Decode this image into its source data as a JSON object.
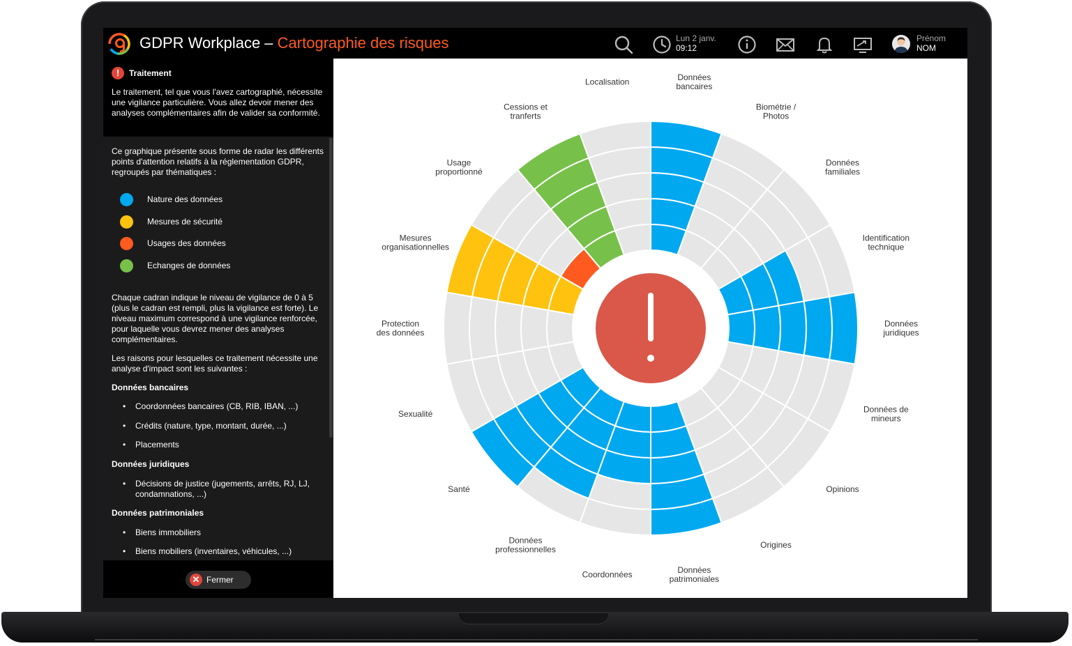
{
  "header": {
    "app_name": "GDPR Workplace – ",
    "page_name": "Cartographie des risques",
    "date": "Lun 2 janv.",
    "time": "09:12",
    "user_first": "Prénom",
    "user_last": "NOM",
    "icons": [
      "search-icon",
      "clock-icon",
      "info-icon",
      "mail-icon",
      "bell-icon",
      "screen-icon",
      "user-avatar"
    ]
  },
  "sidebar": {
    "head_title": "Traitement",
    "head_text": "Le traitement, tel que vous l'avez cartographié, nécessite une vigilance particulière. Vous allez devoir mener des analyses complémentaires afin de valider sa conformité.",
    "intro": "Ce graphique présente sous forme de radar les différents points d'attention relatifs à la réglementation GDPR, regroupés par thématiques :",
    "legend": [
      {
        "label": "Nature des données",
        "color": "#00a8f0"
      },
      {
        "label": "Mesures de sécurité",
        "color": "#ffc20e"
      },
      {
        "label": "Usages des données",
        "color": "#ff5a1f"
      },
      {
        "label": "Echanges de données",
        "color": "#77c14a"
      }
    ],
    "text2": "Chaque cadran indique le niveau de vigilance de 0 à 5 (plus le cadran est rempli, plus la vigilance est forte). Le niveau maximum correspond à une vigilance renforcée, pour laquelle vous devrez mener des analyses complémentaires.",
    "text3": "Les raisons pour lesquelles ce traitement nécessite une analyse d'impact sont les suivantes :",
    "sections": [
      {
        "title": "Données bancaires",
        "items": [
          "Coordonnées bancaires (CB, RIB, IBAN, ...)",
          "Crédits (nature, type, montant, durée, ...)",
          "Placements"
        ]
      },
      {
        "title": "Données juridiques",
        "items": [
          "Décisions de justice (jugements, arrêts, RJ, LJ, condamnations, ...)"
        ]
      },
      {
        "title": "Données patrimoniales",
        "items": [
          "Biens immobiliers",
          "Biens mobiliers (inventaires, véhicules, ...)"
        ]
      }
    ],
    "close_label": "Fermer"
  },
  "chart_data": {
    "type": "radar",
    "max_level": 5,
    "categories": [
      "Localisation",
      "Données bancaires",
      "Biométrie / Photos",
      "Données familiales",
      "Identification technique",
      "Données juridiques",
      "Données de mineurs",
      "Opinions",
      "Origines",
      "Données patrimoniales",
      "Coordonnées",
      "Données professionnelles",
      "Santé",
      "Sexualité",
      "Protection des données",
      "Mesures organisationnelles",
      "Usage proportionné",
      "Cessions et tranferts"
    ],
    "levels": [
      0,
      5,
      0,
      0,
      3,
      5,
      0,
      0,
      0,
      5,
      3,
      4,
      5,
      0,
      0,
      5,
      1,
      5
    ],
    "groups": [
      "nature",
      "nature",
      "nature",
      "nature",
      "nature",
      "nature",
      "nature",
      "nature",
      "nature",
      "nature",
      "nature",
      "nature",
      "nature",
      "nature",
      "security",
      "security",
      "usage",
      "exchange"
    ],
    "colors": {
      "nature": "#00a8f0",
      "security": "#ffc20e",
      "usage": "#ff5a1f",
      "exchange": "#77c14a",
      "empty": "#e6e6e6",
      "center": "#d9584a"
    }
  }
}
